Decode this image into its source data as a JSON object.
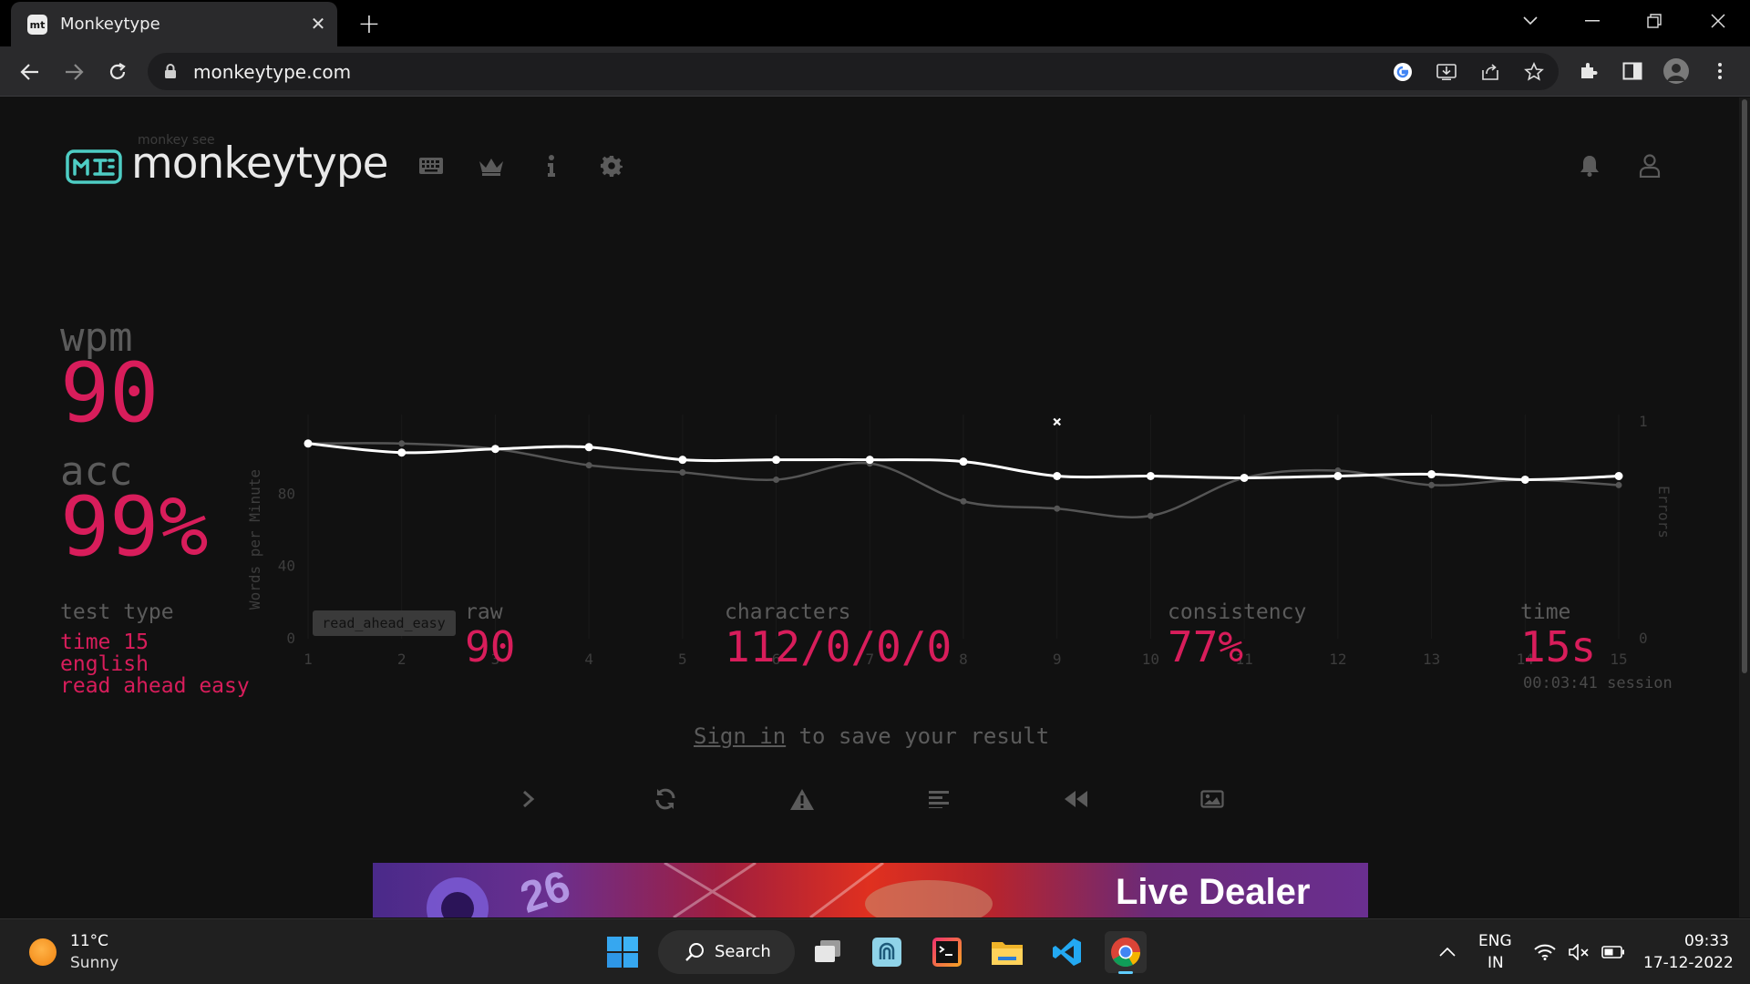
{
  "browser": {
    "tab_title": "Monkeytype",
    "favicon_text": "mt",
    "url": "monkeytype.com"
  },
  "header": {
    "logo_subtitle": "monkey see",
    "logo_text": "monkeytype"
  },
  "result": {
    "wpm_label": "wpm",
    "wpm_value": "90",
    "acc_label": "acc",
    "acc_value": "99%"
  },
  "stats": {
    "test_type_label": "test type",
    "test_type_lines": [
      "time 15",
      "english",
      "read ahead easy"
    ],
    "raw_label": "raw",
    "raw_value": "90",
    "characters_label": "characters",
    "characters_value": "112/0/0/0",
    "consistency_label": "consistency",
    "consistency_value": "77%",
    "time_label": "time",
    "time_value": "15s",
    "session_text": "00:03:41 session"
  },
  "signin": {
    "link_text": "Sign in",
    "rest_text": " to save your result"
  },
  "ad": {
    "headline": "Live Dealer",
    "number": "26"
  },
  "taskbar": {
    "weather_temp": "11°C",
    "weather_cond": "Sunny",
    "search_label": "Search",
    "lang_line1": "ENG",
    "lang_line2": "IN",
    "time": "09:33",
    "date": "17-12-2022"
  },
  "chart_data": {
    "type": "line",
    "ylabel": "Words per Minute",
    "y2label": "Errors",
    "x": [
      1,
      2,
      3,
      4,
      5,
      6,
      7,
      8,
      9,
      10,
      11,
      12,
      13,
      14,
      15
    ],
    "ylim": [
      0,
      120
    ],
    "yticks": [
      0,
      40,
      80
    ],
    "y2lim": [
      0,
      1
    ],
    "y2ticks": [
      0,
      1
    ],
    "series": [
      {
        "name": "wpm",
        "color": "#ffffff",
        "values": [
          108,
          103,
          105,
          106,
          99,
          99,
          99,
          98,
          90,
          90,
          89,
          90,
          91,
          88,
          90
        ]
      },
      {
        "name": "raw",
        "color": "#555555",
        "values": [
          108,
          108,
          105,
          96,
          92,
          88,
          97,
          76,
          72,
          68,
          89,
          93,
          85,
          88,
          85
        ]
      }
    ],
    "errors": [
      {
        "x": 9,
        "value": 1
      }
    ],
    "annotation": "read_ahead_easy",
    "grid": true
  }
}
